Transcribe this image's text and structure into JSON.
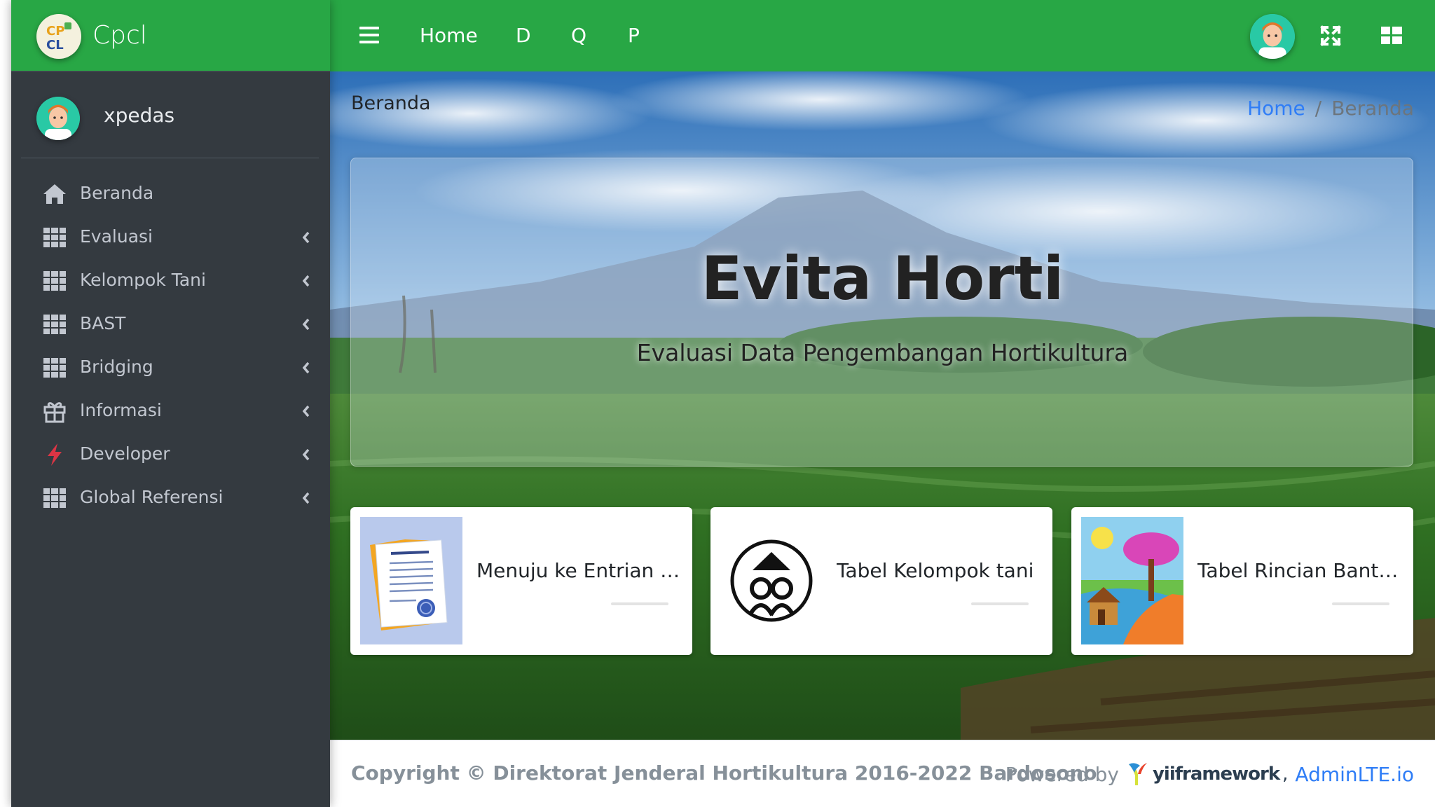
{
  "brand": {
    "name": "Cpcl",
    "logo_text_top": "CP",
    "logo_text_bottom": "CL"
  },
  "user": {
    "name": "xpedas"
  },
  "sidebar": {
    "items": [
      {
        "label": "Beranda",
        "icon": "home-icon",
        "has_submenu": false
      },
      {
        "label": "Evaluasi",
        "icon": "grid-icon",
        "has_submenu": true
      },
      {
        "label": "Kelompok Tani",
        "icon": "grid-icon",
        "has_submenu": true
      },
      {
        "label": "BAST",
        "icon": "grid-icon",
        "has_submenu": true
      },
      {
        "label": "Bridging",
        "icon": "grid-icon",
        "has_submenu": true
      },
      {
        "label": "Informasi",
        "icon": "gift-icon",
        "has_submenu": true
      },
      {
        "label": "Developer",
        "icon": "bolt-icon",
        "has_submenu": true
      },
      {
        "label": "Global Referensi",
        "icon": "grid-icon",
        "has_submenu": true
      }
    ]
  },
  "topbar": {
    "links": [
      "Home",
      "D",
      "Q",
      "P"
    ],
    "icons": [
      "menu-icon",
      "user-avatar",
      "fullscreen-icon",
      "apps-icon"
    ]
  },
  "breadcrumb": {
    "page_title": "Beranda",
    "home": "Home",
    "separator": "/",
    "active": "Beranda"
  },
  "hero": {
    "title": "Evita Horti",
    "subtitle": "Evaluasi Data Pengembangan Hortikultura"
  },
  "cards": [
    {
      "label": "Menuju ke Entrian SK",
      "icon": "document-icon"
    },
    {
      "label": "Tabel Kelompok tani",
      "icon": "farmer-group-icon"
    },
    {
      "label": "Tabel Rincian Bantu...",
      "icon": "landscape-painting-icon"
    }
  ],
  "footer": {
    "copyright": "Copyright © Direktorat Jenderal Hortikultura 2016-2022 Bardosono",
    "powered_by": "Powered by",
    "yii": "yiiframework",
    "yii_comma": ",",
    "adminlte": "AdminLTE.io"
  },
  "colors": {
    "primary_green": "#28a745",
    "sidebar_bg": "#343a40",
    "link_blue": "#2f7df6"
  }
}
